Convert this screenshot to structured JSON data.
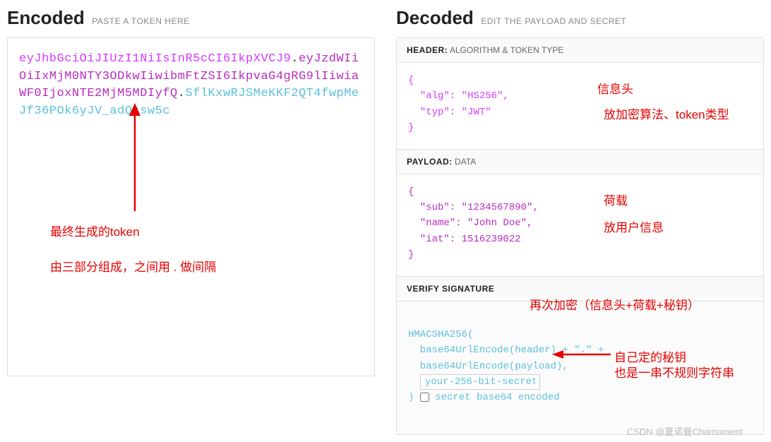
{
  "encoded": {
    "title": "Encoded",
    "subtitle": "PASTE A TOKEN HERE",
    "token_header": "eyJhbGciOiJIUzI1NiIsInR5cCI6IkpXVCJ9",
    "token_payload": "eyJzdWIiOiIxMjM0NTY3ODkwIiwibmFtZSI6IkpvaG4gRG9lIiwiaWF0IjoxNTE2MjM5MDIyfQ",
    "token_signature": "SflKxwRJSMeKKF2QT4fwpMeJf36POk6yJV_adQssw5c"
  },
  "decoded": {
    "title": "Decoded",
    "subtitle": "EDIT THE PAYLOAD AND SECRET",
    "header_section": {
      "label_bold": "HEADER:",
      "label_rest": "ALGORITHM & TOKEN TYPE",
      "json": "{\n  \"alg\": \"HS256\",\n  \"typ\": \"JWT\"\n}"
    },
    "payload_section": {
      "label_bold": "PAYLOAD:",
      "label_rest": "DATA",
      "json": "{\n  \"sub\": \"1234567890\",\n  \"name\": \"John Doe\",\n  \"iat\": 1516239022\n}"
    },
    "verify_section": {
      "label_bold": "VERIFY SIGNATURE",
      "line1": "HMACSHA256(",
      "line2": "  base64UrlEncode(header) + \".\" +",
      "line3": "  base64UrlEncode(payload),",
      "secret_value": "your-256-bit-secret",
      "line_close": ") ",
      "checkbox_label": "secret base64 encoded"
    }
  },
  "annotations": {
    "encoded_note1": "最终生成的token",
    "encoded_note2": "由三部分组成，之间用 . 做间隔",
    "header_note1": "信息头",
    "header_note2": "放加密算法、token类型",
    "payload_note1": "荷载",
    "payload_note2": "放用户信息",
    "verify_note1": "再次加密（信息头+荷载+秘钥）",
    "verify_note2": "自己定的秘钥",
    "verify_note3": "也是一串不规则字符串"
  },
  "watermark": "CSDN @夏诺曼Charnament"
}
